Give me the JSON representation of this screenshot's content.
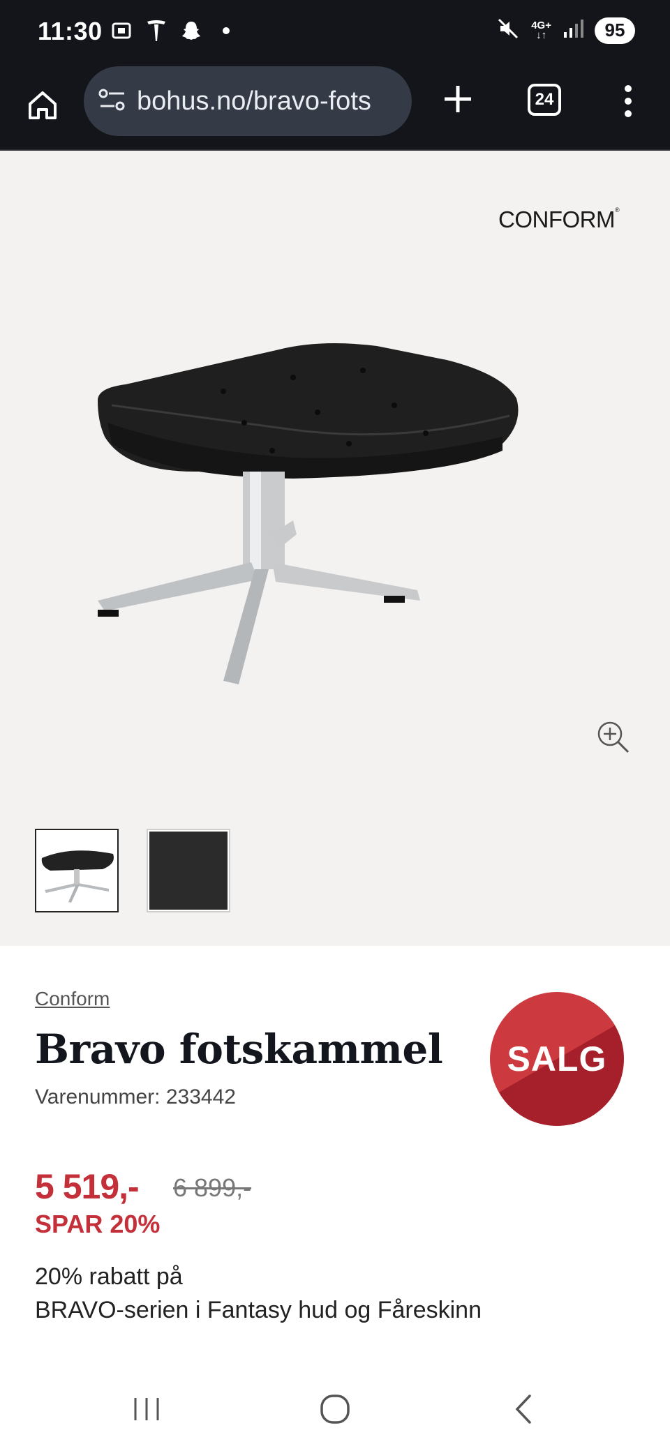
{
  "status_bar": {
    "time": "11:30",
    "network": "4G+",
    "battery": "95"
  },
  "browser": {
    "url": "bohus.no/bravo-fots",
    "tab_count": "24"
  },
  "gallery": {
    "brand_logo": "CONFORM",
    "thumbnails": [
      "product-photo",
      "leather-swatch"
    ]
  },
  "product": {
    "brand": "Conform",
    "title": "Bravo fotskammel",
    "sku": "Varenummer: 233442",
    "badge": "SALG",
    "price": "5 519,-",
    "old_price": "6 899,-",
    "save": "SPAR 20%",
    "promo_line1": "20% rabatt på",
    "promo_line2": "BRAVO-serien i Fantasy hud og Fåreskinn"
  },
  "colors": {
    "sale_red": "#c4303a",
    "dark_bar": "#13151a",
    "gallery_bg": "#f4f2f0"
  }
}
